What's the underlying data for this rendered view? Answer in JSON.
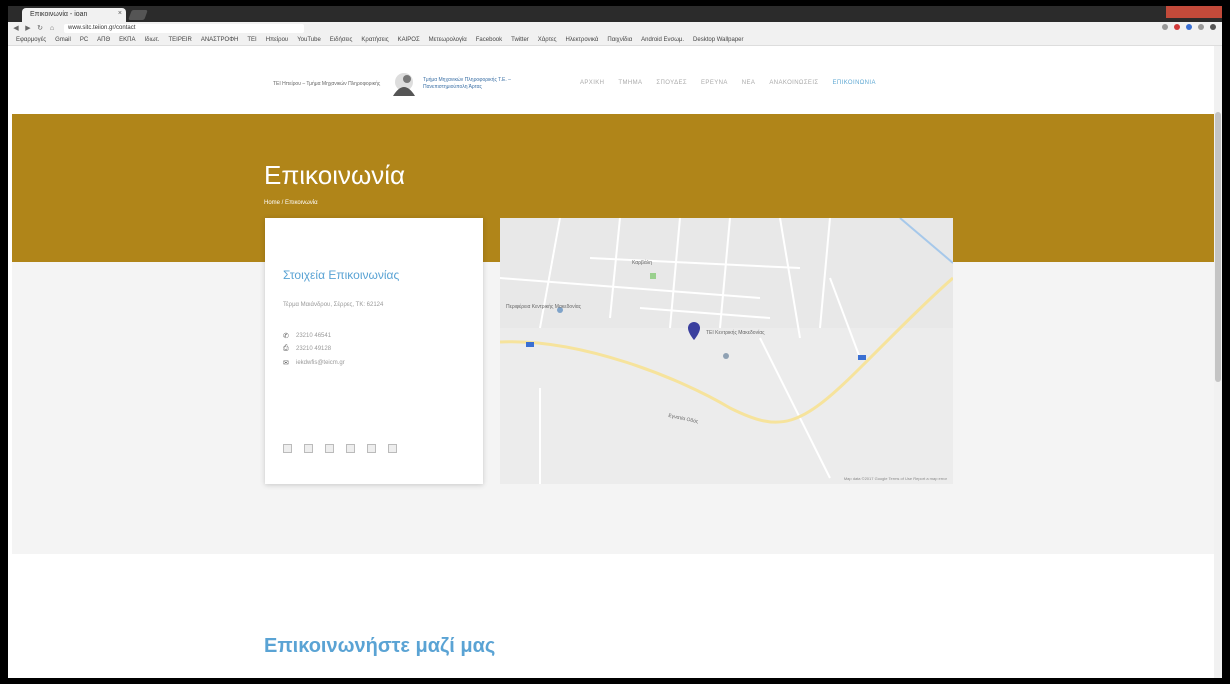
{
  "browser": {
    "tab_title": "Επικοινωνία - ioan",
    "tab_close": "×",
    "url": "www.sitc.teiion.gr/contact",
    "bookmarks": [
      "Εφαρμογές",
      "Gmail",
      "PC",
      "ΑΠΘ",
      "ΕΚΠΑ",
      "Ιδιωτ.",
      "TEIPEIR",
      "ΑΝΑΣΤΡΟΦΗ",
      "ΤΕΙ",
      "Ηπείρου",
      "YouTube",
      "Ειδήσεις",
      "Κρατήσεις",
      "ΚΑΙΡΟΣ",
      "Μετεωρολογία",
      "Facebook",
      "Twitter",
      "Χάρτες",
      "Ηλεκτρονικά",
      "Παιχνίδια",
      "Android Ενσωμ.",
      "Desktop Wallpaper"
    ]
  },
  "site": {
    "logo_left": "ΤΕΙ Ηπείρου – Τμήμα Μηχανικών Πληροφορικής",
    "logo_right": "Τμήμα Μηχανικών Πληροφορικής Τ.Ε. – Πανεπιστημιούπολη Άρτας",
    "nav": [
      "ΑΡΧΙΚΗ",
      "ΤΜΗΜΑ",
      "ΣΠΟΥΔΕΣ",
      "ΕΡΕΥΝΑ",
      "ΝΕΑ",
      "ΑΝΑΚΟΙΝΩΣΕΙΣ",
      "ΕΠΙΚΟΙΝΩΝΙΑ"
    ],
    "active_nav": "ΕΠΙΚΟΙΝΩΝΙΑ"
  },
  "hero": {
    "title": "Επικοινωνία",
    "breadcrumb": "Home / Επικοινωνία"
  },
  "card": {
    "title": "Στοιχεία Επικοινωνίας",
    "address": "Τέρμα Μαιάνδρου, Σέρρες, ΤΚ: 62124",
    "phone": "23210 46541",
    "fax": "23210 49128",
    "email": "iekdwfis@teicm.gr",
    "phone_icon": "phone-icon",
    "fax_icon": "fax-icon",
    "email_icon": "envelope-icon"
  },
  "map": {
    "places": [
      "Περιφέρεια Κεντρικής Μακεδονίας",
      "ΤΕΙ Κεντρικής Μακεδονίας",
      "Εγνατία Οδός",
      "Καρβάλη"
    ],
    "credit": "Map data ©2017 Google   Terms of Use   Report a map error"
  },
  "section": {
    "contact_title": "Επικοινωνήστε μαζί μας"
  },
  "colors": {
    "hero": "#b08519",
    "accent": "#5aa3d4",
    "map_pin": "#3a3f9e"
  }
}
